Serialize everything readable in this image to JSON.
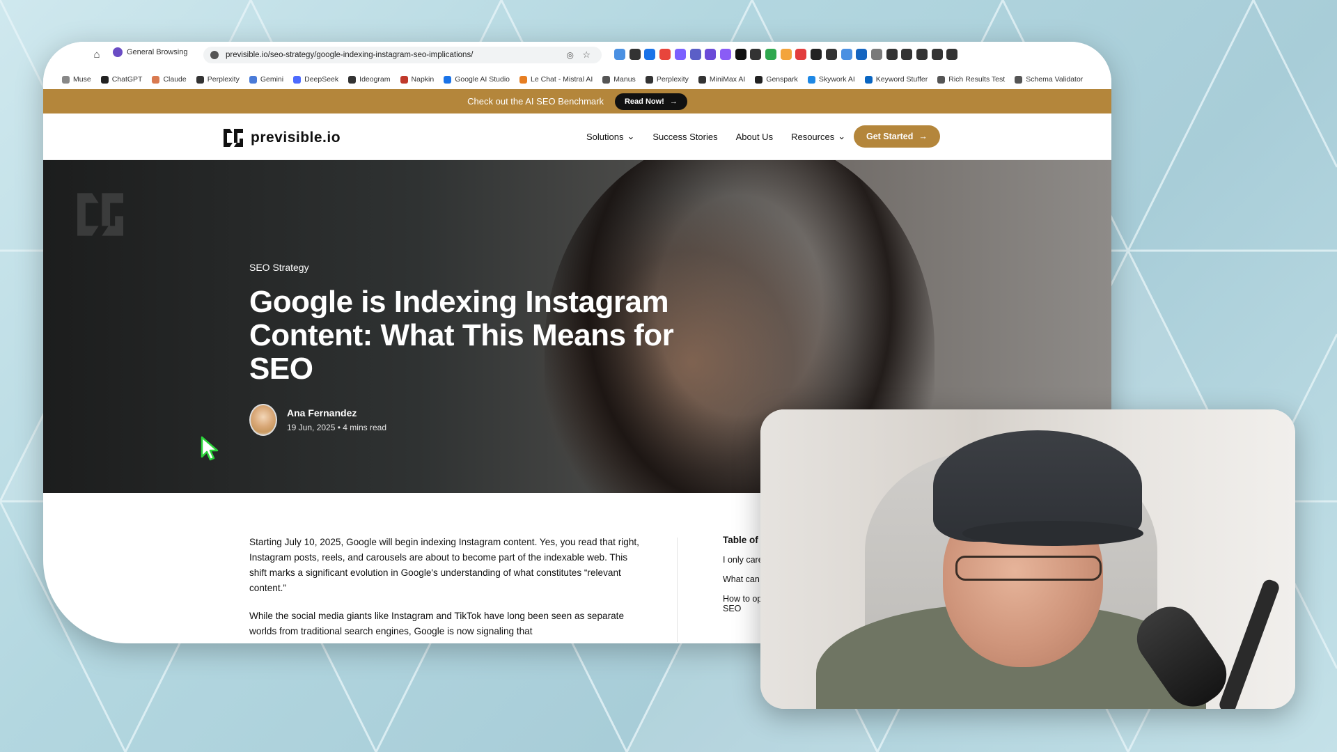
{
  "browser": {
    "profile_label": "General Browsing",
    "url": "previsible.io/seo-strategy/google-indexing-instagram-seo-implications/",
    "bookmarks": [
      "Muse",
      "ChatGPT",
      "Claude",
      "Perplexity",
      "Gemini",
      "DeepSeek",
      "Ideogram",
      "Napkin",
      "Google AI Studio",
      "Le Chat - Mistral AI",
      "Manus",
      "Perplexity",
      "MiniMax AI",
      "Genspark",
      "Skywork AI",
      "Keyword Stuffer",
      "Rich Results Test",
      "Schema Validator"
    ],
    "extension_colors": [
      "#4a90e2",
      "#333333",
      "#1a73e8",
      "#e8453c",
      "#7b61ff",
      "#5b5fc7",
      "#6b4bd8",
      "#8a5cf6",
      "#111111",
      "#333333",
      "#2fa84f",
      "#f3a43b",
      "#e23d3d",
      "#222222",
      "#333333",
      "#4a90e2",
      "#1565c0",
      "#7a7a7a",
      "#333333",
      "#333333",
      "#333333",
      "#333333",
      "#333333"
    ]
  },
  "promo": {
    "text": "Check out the AI SEO Benchmark",
    "button": "Read Now!"
  },
  "nav": {
    "logo": "previsible.io",
    "links": [
      "Solutions",
      "Success Stories",
      "About Us",
      "Resources"
    ],
    "cta": "Get Started"
  },
  "hero": {
    "category": "SEO Strategy",
    "title": "Google is Indexing Instagram Content: What This Means for SEO",
    "author": "Ana Fernandez",
    "date": "19 Jun, 2025",
    "read_time": "4 mins read"
  },
  "article": {
    "paragraphs": [
      "Starting July 10, 2025, Google will begin indexing Instagram content. Yes, you read that right, Instagram posts, reels, and carousels are about to become part of the indexable web. This shift marks a significant evolution in Google's understanding of what constitutes “relevant content.”",
      "While the social media giants like Instagram and TikTok have long been seen as separate worlds from traditional search engines, Google is now signaling that"
    ]
  },
  "toc": {
    "heading": "Table of",
    "items": [
      "I only care",
      "What can",
      "How to op",
      "SEO"
    ]
  },
  "colors": {
    "accent": "#b4863b",
    "background": "#b3d7e0"
  }
}
